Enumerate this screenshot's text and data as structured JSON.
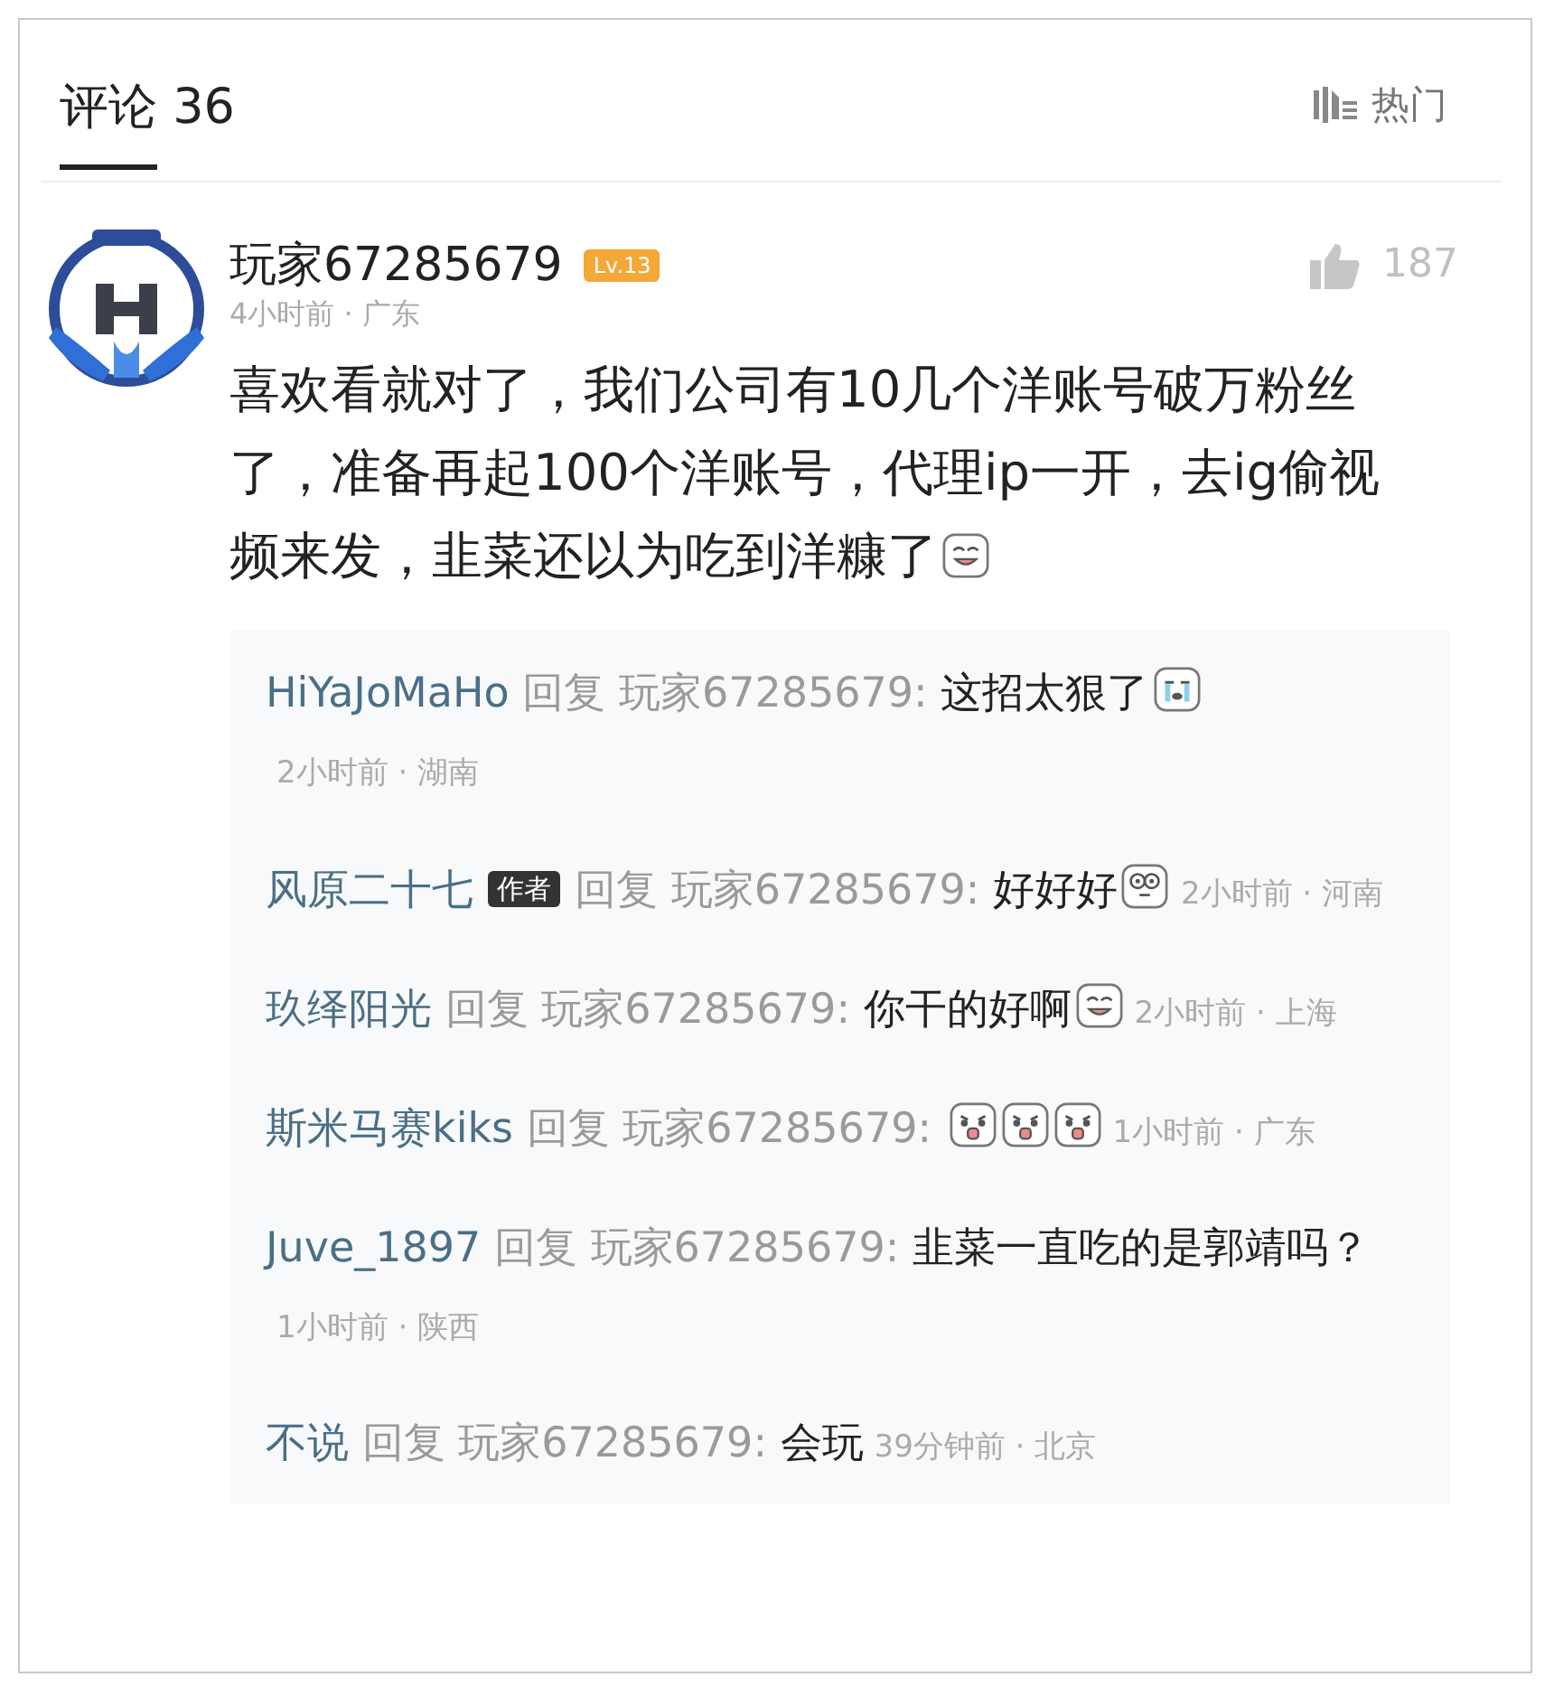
{
  "header": {
    "title": "评论",
    "count": "36",
    "sort_label": "热门"
  },
  "comment": {
    "user": "玩家67285679",
    "level_badge": "Lv.13",
    "time": "4小时前 · 广东",
    "likes": "187",
    "text": "喜欢看就对了，我们公司有10几个洋账号破万粉丝了，准备再起100个洋账号，代理ip一开，去ig偷视频来发，韭菜还以为吃到洋糠了",
    "emojis": [
      {
        "kind": "smile"
      }
    ]
  },
  "replies": [
    {
      "user": "HiYaJoMaHo",
      "reply_word": "回复",
      "target": "玩家67285679:",
      "text": "这招太狠了",
      "emojis": [
        {
          "kind": "cry"
        }
      ],
      "meta": "2小时前 · 湖南"
    },
    {
      "user": "风原二十七",
      "author_badge": "作者",
      "reply_word": "回复",
      "target": "玩家67285679:",
      "text": "好好好",
      "emojis": [
        {
          "kind": "dizzy"
        }
      ],
      "meta": "2小时前 · 河南"
    },
    {
      "user": "玖绎阳光",
      "reply_word": "回复",
      "target": "玩家67285679:",
      "text": "你干的好啊",
      "emojis": [
        {
          "kind": "smile"
        }
      ],
      "meta": "2小时前 · 上海"
    },
    {
      "user": "斯米马赛kiks",
      "reply_word": "回复",
      "target": "玩家67285679:",
      "emojis": [
        {
          "kind": "shock"
        },
        {
          "kind": "shock"
        },
        {
          "kind": "shock"
        }
      ],
      "meta": "1小时前 · 广东"
    },
    {
      "user": "Juve_1897",
      "reply_word": "回复",
      "target": "玩家67285679:",
      "text": "韭菜一直吃的是郭靖吗？",
      "meta": "1小时前 · 陕西"
    },
    {
      "user": "不说",
      "reply_word": "回复",
      "target": "玩家67285679:",
      "text": "会玩",
      "meta": "39分钟前 · 北京"
    }
  ]
}
